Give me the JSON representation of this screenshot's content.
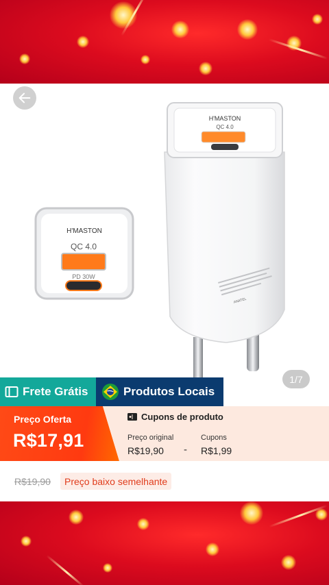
{
  "nav": {
    "back_icon": "back-arrow-icon"
  },
  "gallery": {
    "counter": "1/7",
    "brand_small": "H'MASTON",
    "brand_large": "H'MASTON",
    "qc_small": "QC 4.0",
    "qc_large": "QC 4.0",
    "pd_label": "PD 30W",
    "model_label": "ANATEL"
  },
  "badges": {
    "free_shipping": "Frete Grátis",
    "free_shipping_icon": "shipping-ticket-icon",
    "local_products": "Produtos Locais",
    "local_products_icon": "brazil-flag-icon"
  },
  "offer": {
    "label": "Preço Oferta",
    "price": "R$17,91"
  },
  "coupons": {
    "title": "Cupons de produto",
    "title_icon": "coupon-icon",
    "original_label": "Preço original",
    "original_value": "R$19,90",
    "separator": "-",
    "coupon_label": "Cupons",
    "coupon_value": "R$1,99"
  },
  "pricing": {
    "old_price": "R$19,90",
    "low_price_tag": "Preço baixo semelhante"
  },
  "colors": {
    "accent_orange": "#ff4a16",
    "teal": "#13a89a",
    "navy": "#0b3b6f",
    "festive_red": "#d4061c"
  }
}
